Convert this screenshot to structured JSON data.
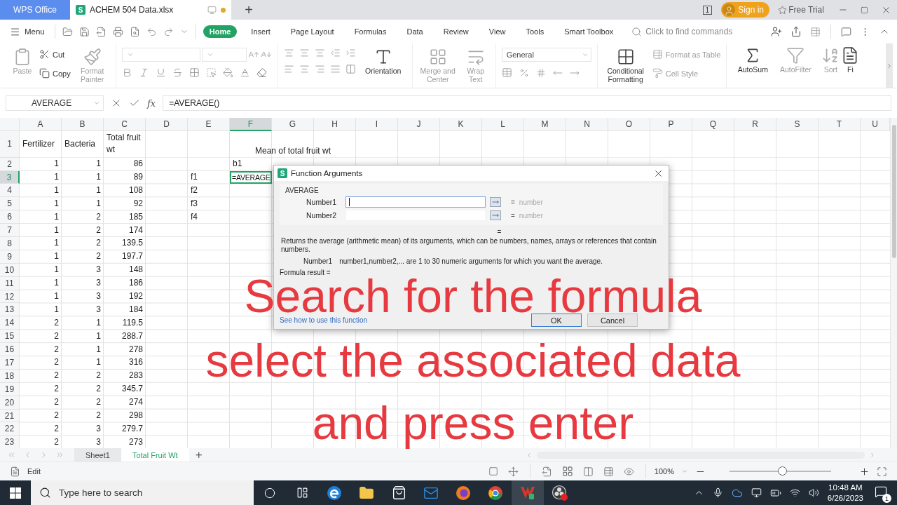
{
  "title_bar": {
    "home_tab": "WPS Office",
    "doc_tab": {
      "app_letter": "S",
      "title": "ACHEM 504 Data.xlsx",
      "unsaved": true
    },
    "new_tab": "+",
    "window_count": "1",
    "sign_in": "Sign in",
    "free_trial": "Free Trial"
  },
  "menu_bar": {
    "menu": "Menu",
    "tabs": [
      {
        "label": "Home",
        "selected": true
      },
      {
        "label": "Insert",
        "selected": false
      },
      {
        "label": "Page Layout",
        "selected": false
      },
      {
        "label": "Formulas",
        "selected": false
      },
      {
        "label": "Data",
        "selected": false
      },
      {
        "label": "Review",
        "selected": false
      },
      {
        "label": "View",
        "selected": false
      },
      {
        "label": "Tools",
        "selected": false
      },
      {
        "label": "Smart Toolbox",
        "selected": false
      }
    ],
    "search": {
      "placeholder": "Click to find commands"
    }
  },
  "ribbon": {
    "paste": {
      "label": "Paste",
      "disabled": true
    },
    "cut": {
      "label": "Cut",
      "disabled": false
    },
    "copy": {
      "label": "Copy",
      "disabled": false
    },
    "format_painter": {
      "label": "Format Painter",
      "disabled": true
    },
    "orientation": {
      "label": "Orientation",
      "disabled": false
    },
    "merge": {
      "label": "Merge and Center",
      "disabled": true
    },
    "wrap": {
      "label": "Wrap Text",
      "disabled": true
    },
    "number_format": "General",
    "conditional": {
      "label": "Conditional Formatting",
      "disabled": false
    },
    "format_table": {
      "label": "Format as Table",
      "disabled": true
    },
    "cell_style": {
      "label": "Cell Style",
      "disabled": true
    },
    "autosum": {
      "label": "AutoSum",
      "disabled": false
    },
    "autofilter": {
      "label": "AutoFilter",
      "disabled": true
    },
    "sort": {
      "label": "Sort",
      "disabled": true
    },
    "cut_off": {
      "label": "Fi",
      "disabled": false
    }
  },
  "formula_bar": {
    "name_box": "AVERAGE",
    "fx": "fx",
    "formula": "=AVERAGE()"
  },
  "grid": {
    "columns": [
      {
        "label": "A",
        "selected": false
      },
      {
        "label": "B",
        "selected": false
      },
      {
        "label": "C",
        "selected": false
      },
      {
        "label": "D",
        "selected": false
      },
      {
        "label": "E",
        "selected": false
      },
      {
        "label": "F",
        "selected": true
      },
      {
        "label": "G",
        "selected": false
      },
      {
        "label": "H",
        "selected": false
      },
      {
        "label": "I",
        "selected": false
      },
      {
        "label": "J",
        "selected": false
      },
      {
        "label": "K",
        "selected": false
      },
      {
        "label": "L",
        "selected": false
      },
      {
        "label": "M",
        "selected": false
      },
      {
        "label": "N",
        "selected": false
      },
      {
        "label": "O",
        "selected": false
      },
      {
        "label": "P",
        "selected": false
      },
      {
        "label": "Q",
        "selected": false
      },
      {
        "label": "R",
        "selected": false
      },
      {
        "label": "S",
        "selected": false
      },
      {
        "label": "T",
        "selected": false
      },
      {
        "label": "U",
        "selected": false
      }
    ],
    "rows": [
      {
        "number": "1",
        "selected": false,
        "cells": [
          "Fertilizer",
          "Bacteria",
          "Total fruit wt",
          null,
          null,
          null,
          {
            "text": "Mean of total fruit wt",
            "kind": "centered"
          }
        ]
      },
      {
        "number": "2",
        "selected": false,
        "cells": [
          "1",
          "1",
          "86",
          null,
          null,
          "b1"
        ]
      },
      {
        "number": "3",
        "selected": true,
        "cells": [
          "1",
          "1",
          "89",
          null,
          "f1",
          "=AVERAGE"
        ]
      },
      {
        "number": "4",
        "selected": false,
        "cells": [
          "1",
          "1",
          "108",
          null,
          "f2"
        ]
      },
      {
        "number": "5",
        "selected": false,
        "cells": [
          "1",
          "1",
          "92",
          null,
          "f3"
        ]
      },
      {
        "number": "6",
        "selected": false,
        "cells": [
          "1",
          "2",
          "185",
          null,
          "f4"
        ]
      },
      {
        "number": "7",
        "selected": false,
        "cells": [
          "1",
          "2",
          "174"
        ]
      },
      {
        "number": "8",
        "selected": false,
        "cells": [
          "1",
          "2",
          "139.5"
        ]
      },
      {
        "number": "9",
        "selected": false,
        "cells": [
          "1",
          "2",
          "197.7"
        ]
      },
      {
        "number": "10",
        "selected": false,
        "cells": [
          "1",
          "3",
          "148"
        ]
      },
      {
        "number": "11",
        "selected": false,
        "cells": [
          "1",
          "3",
          "186"
        ]
      },
      {
        "number": "12",
        "selected": false,
        "cells": [
          "1",
          "3",
          "192"
        ]
      },
      {
        "number": "13",
        "selected": false,
        "cells": [
          "1",
          "3",
          "184"
        ]
      },
      {
        "number": "14",
        "selected": false,
        "cells": [
          "2",
          "1",
          "119.5"
        ]
      },
      {
        "number": "15",
        "selected": false,
        "cells": [
          "2",
          "1",
          "288.7"
        ]
      },
      {
        "number": "16",
        "selected": false,
        "cells": [
          "2",
          "1",
          "278"
        ]
      },
      {
        "number": "17",
        "selected": false,
        "cells": [
          "2",
          "1",
          "316"
        ]
      },
      {
        "number": "18",
        "selected": false,
        "cells": [
          "2",
          "2",
          "283"
        ]
      },
      {
        "number": "19",
        "selected": false,
        "cells": [
          "2",
          "2",
          "345.7"
        ]
      },
      {
        "number": "20",
        "selected": false,
        "cells": [
          "2",
          "2",
          "274"
        ]
      },
      {
        "number": "21",
        "selected": false,
        "cells": [
          "2",
          "2",
          "298"
        ]
      },
      {
        "number": "22",
        "selected": false,
        "cells": [
          "2",
          "3",
          "279.7"
        ]
      },
      {
        "number": "23",
        "selected": false,
        "cells": [
          "2",
          "3",
          "273"
        ]
      }
    ]
  },
  "dialog": {
    "app_letter": "S",
    "title": "Function Arguments",
    "function": "AVERAGE",
    "arguments": [
      {
        "label": "Number1",
        "equals": "=",
        "hint": "number",
        "focused": true
      },
      {
        "label": "Number2",
        "equals": "=",
        "hint": "number",
        "focused": false
      }
    ],
    "result_equals": "=",
    "description": "Returns the average (arithmetic mean) of its arguments, which can be numbers, names, arrays or references that contain numbers.",
    "argument_help": {
      "name": "Number1",
      "text": "number1,number2,... are 1 to 30 numeric arguments for which you want the average."
    },
    "formula_result": "Formula result =",
    "help_link": "See how to use this function",
    "buttons": [
      {
        "label": "OK",
        "default": true
      },
      {
        "label": "Cancel",
        "default": false
      }
    ]
  },
  "caption": {
    "lines": [
      "Search for the formula",
      "select the associated data",
      "and press enter"
    ]
  },
  "sheet_tabs": {
    "tabs": [
      {
        "label": "Sheet1",
        "selected": false
      },
      {
        "label": "Total Fruit Wt",
        "selected": true
      }
    ],
    "add": "+"
  },
  "status_bar": {
    "mode": "Edit",
    "zoom": "100%",
    "zoom_slider": {
      "level": 0.52
    }
  },
  "taskbar": {
    "search_placeholder": "Type here to search",
    "time": "10:48 AM",
    "date": "6/26/2023",
    "notifications": "1"
  }
}
